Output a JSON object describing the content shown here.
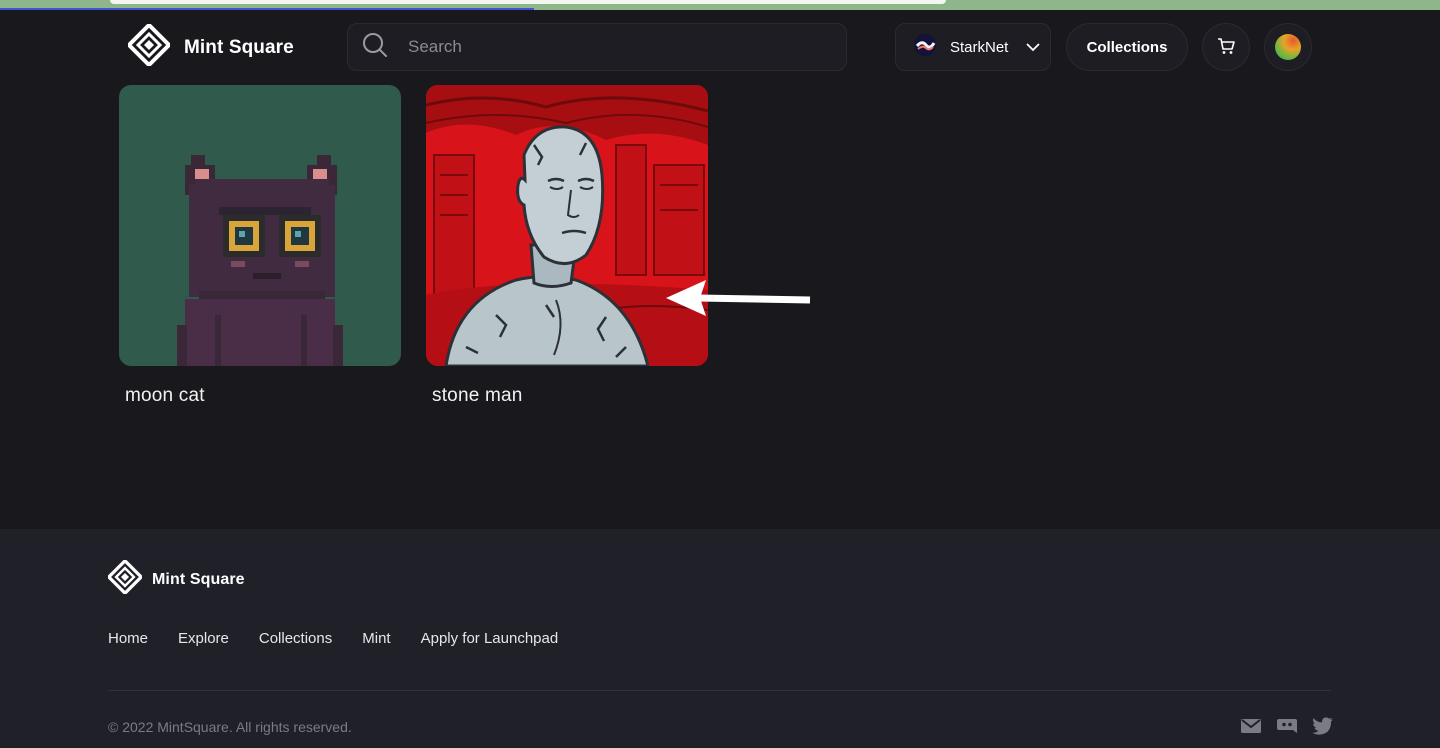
{
  "brand": {
    "name": "Mint Square"
  },
  "header": {
    "search_placeholder": "Search",
    "network_label": "StarkNet",
    "collections_label": "Collections"
  },
  "cards": [
    {
      "title": "moon cat"
    },
    {
      "title": "stone man"
    }
  ],
  "footer": {
    "brand": "Mint Square",
    "links": [
      "Home",
      "Explore",
      "Collections",
      "Mint",
      "Apply for Launchpad"
    ],
    "copyright": "© 2022 MintSquare. All rights reserved."
  },
  "icons": {
    "logo": "diamond-logo-icon",
    "search": "search-icon",
    "network": "starknet-icon",
    "chevron": "chevron-down-icon",
    "cart": "cart-icon",
    "email": "email-icon",
    "discord": "discord-icon",
    "twitter": "twitter-icon"
  },
  "colors": {
    "background": "#18181d",
    "footer": "#202029",
    "moon_cat_bg": "#2f5a4c",
    "stone_man_bg": "#d8131a"
  }
}
